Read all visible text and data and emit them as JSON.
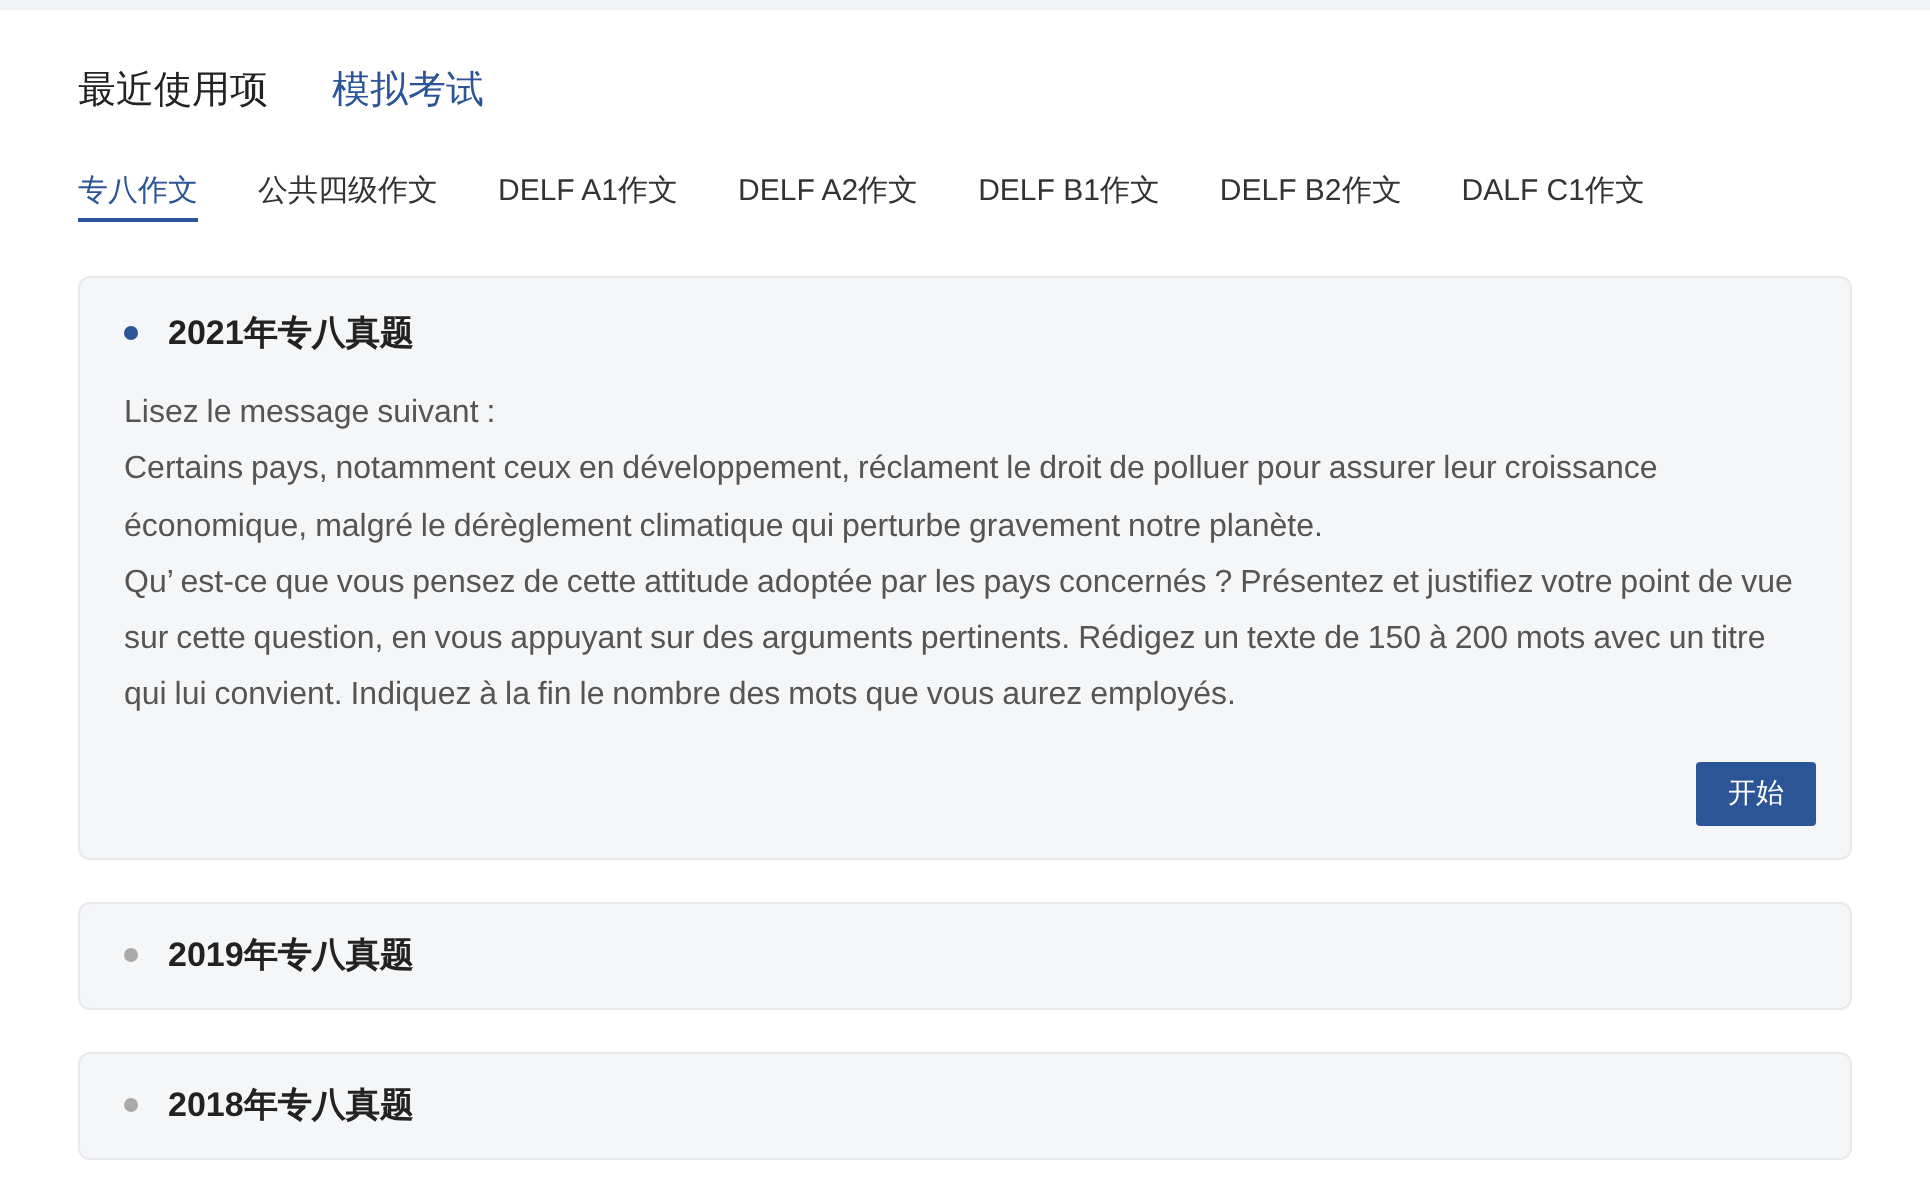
{
  "top_tabs": [
    {
      "label": "最近使用项",
      "selected": false
    },
    {
      "label": "模拟考试",
      "selected": true
    }
  ],
  "sub_tabs": [
    {
      "label": "专八作文",
      "selected": true
    },
    {
      "label": "公共四级作文",
      "selected": false
    },
    {
      "label": "DELF A1作文",
      "selected": false
    },
    {
      "label": "DELF A2作文",
      "selected": false
    },
    {
      "label": "DELF B1作文",
      "selected": false
    },
    {
      "label": "DELF B2作文",
      "selected": false
    },
    {
      "label": "DALF C1作文",
      "selected": false
    }
  ],
  "exams": [
    {
      "title": "2021年专八真题",
      "expanded": true,
      "paragraphs": [
        "Lisez le message suivant :",
        "Certains pays, notamment ceux en développement, réclament le droit de polluer pour assurer leur croissance économique, malgré le dérèglement climatique qui perturbe gravement notre planète.",
        "Qu’ est-ce que vous pensez de cette attitude adoptée par les pays concernés ? Présentez et justifiez votre point de vue sur cette question, en vous appuyant sur des arguments pertinents. Rédigez un texte de 150 à 200 mots avec un titre qui lui convient. Indiquez à la fin le nombre des mots que vous aurez employés."
      ],
      "button": "开始"
    },
    {
      "title": "2019年专八真题",
      "expanded": false
    },
    {
      "title": "2018年专八真题",
      "expanded": false
    }
  ]
}
